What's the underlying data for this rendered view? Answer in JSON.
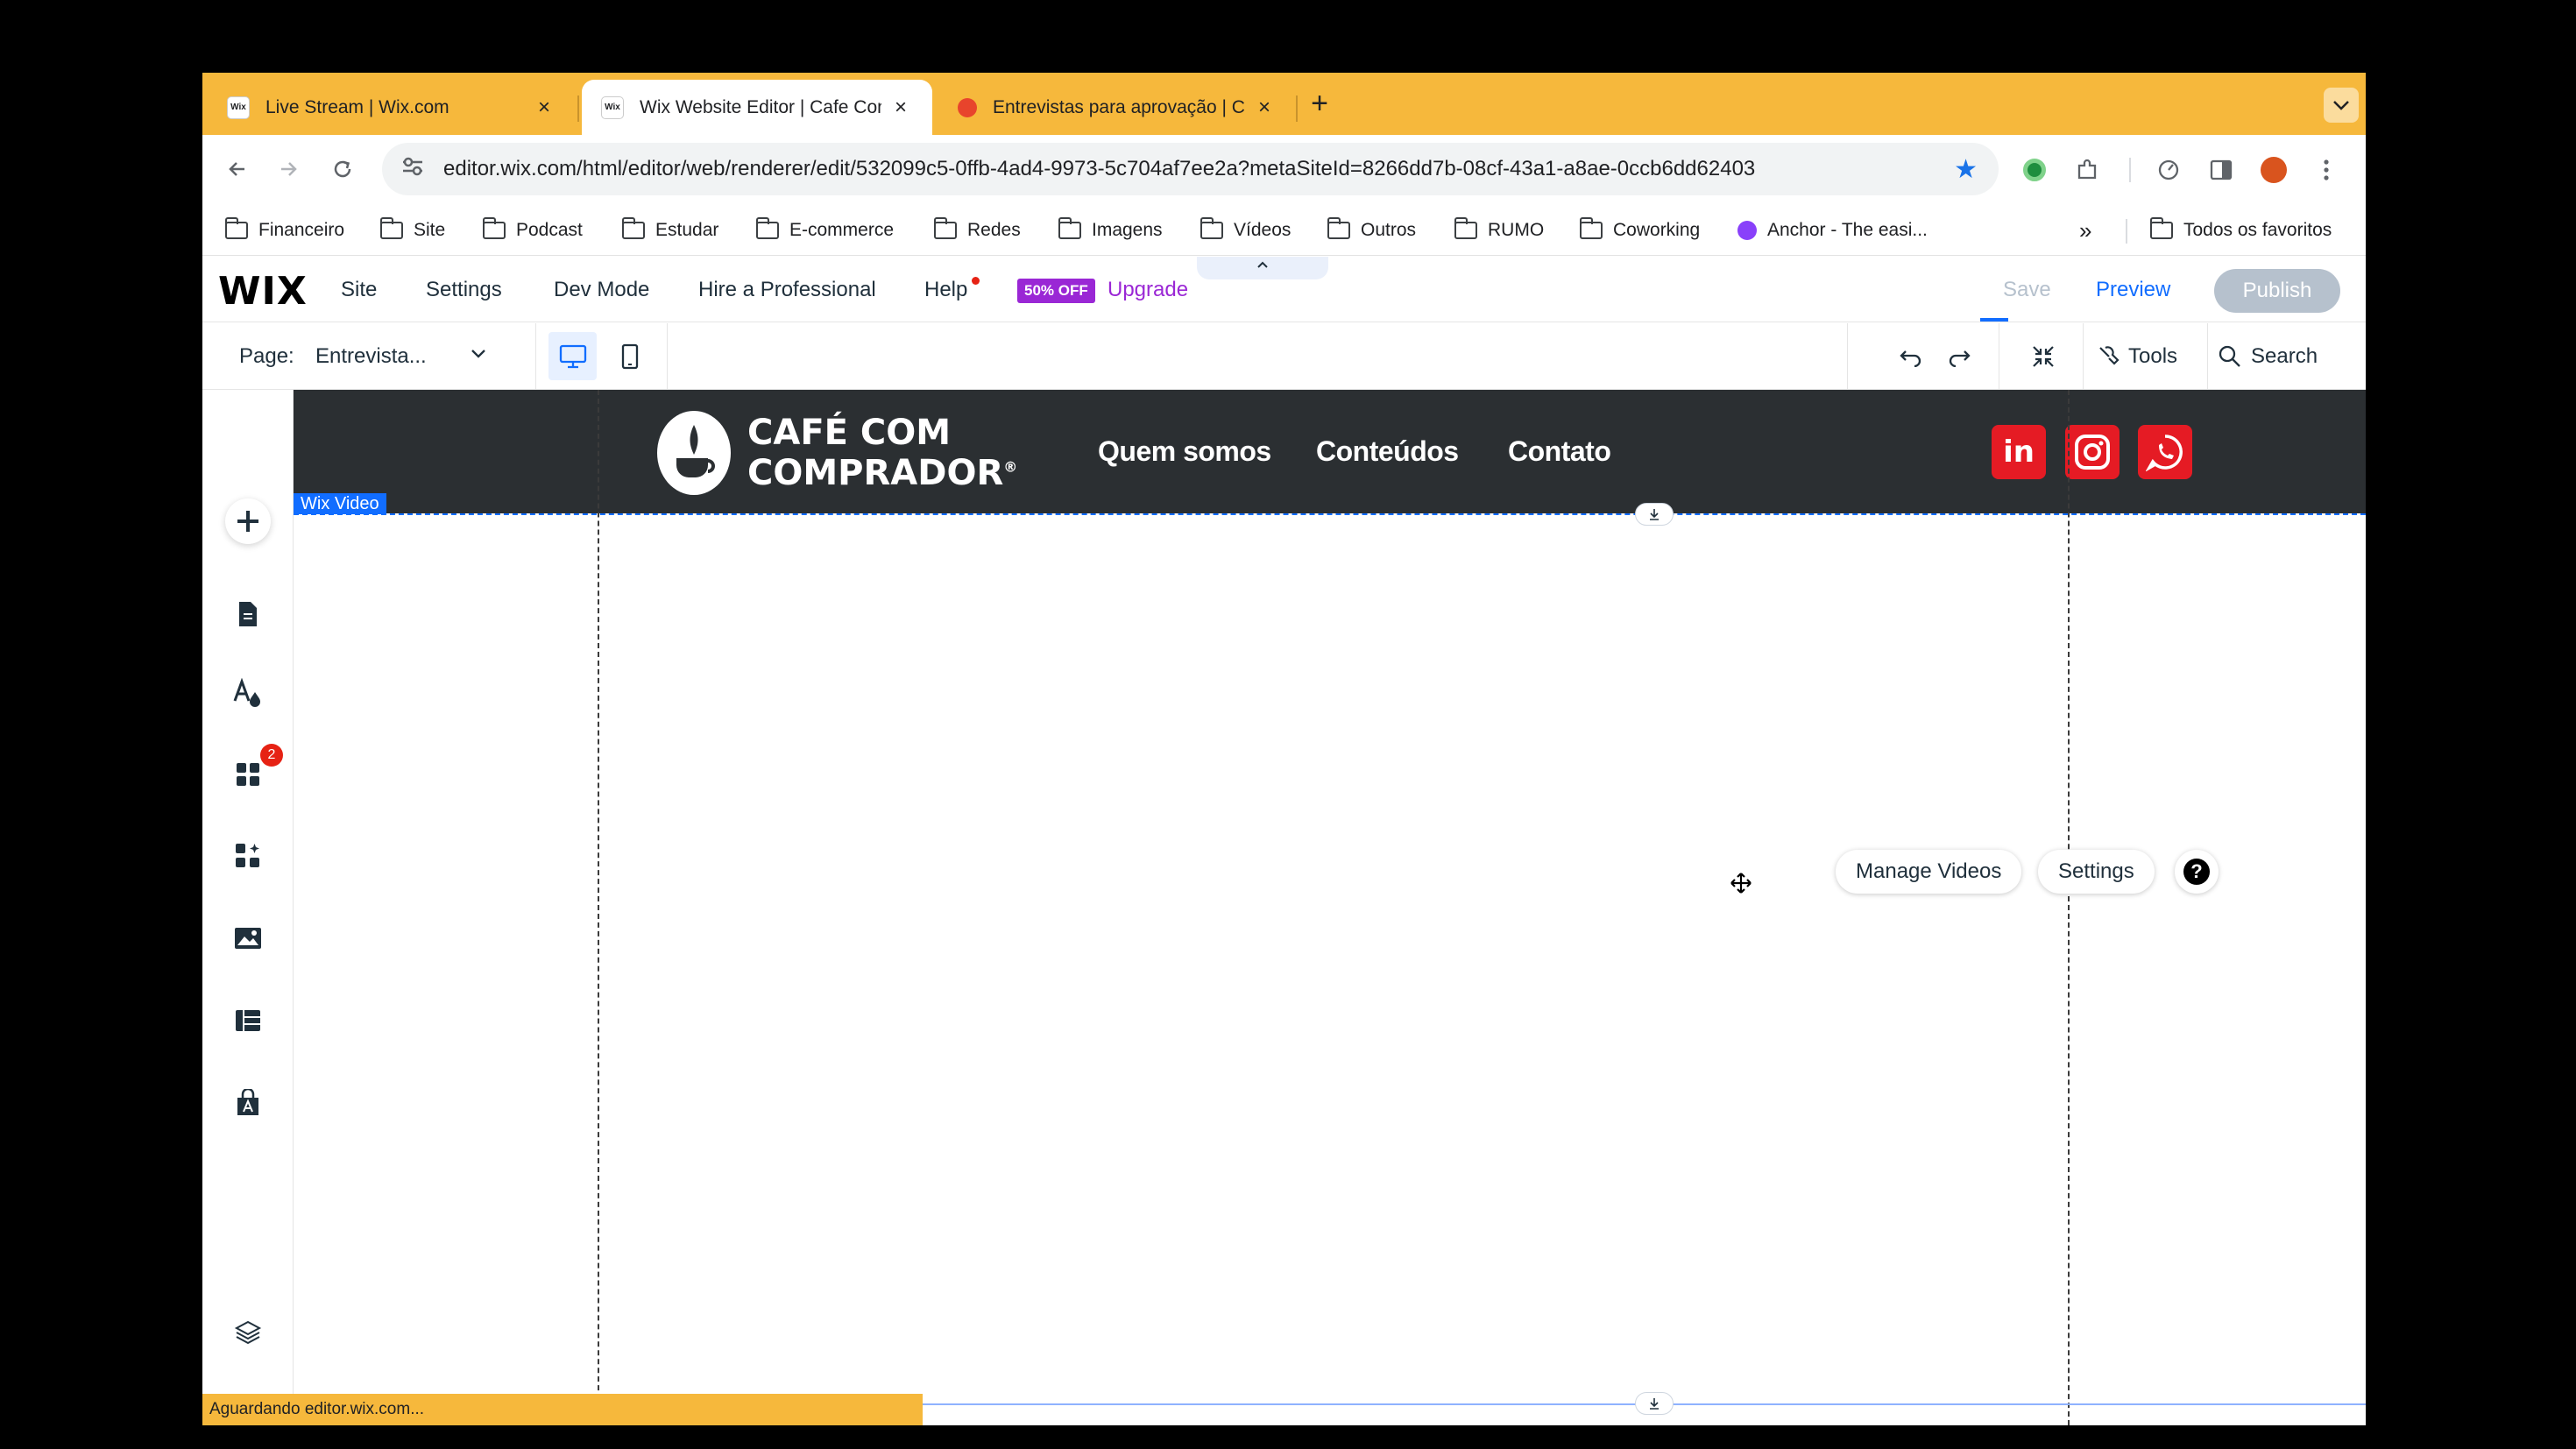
{
  "browser": {
    "tabs": [
      {
        "label": "Live Stream | Wix.com",
        "close": "×",
        "favicon_color": "#ffffff"
      },
      {
        "label": "Wix Website Editor | Cafe Com",
        "close": "×",
        "favicon_color": "#ffffff"
      },
      {
        "label": "Entrevistas para aprovação | C",
        "close": "×",
        "favicon_color": "#e8442c"
      }
    ],
    "new_tab": "+",
    "url": "editor.wix.com/html/editor/web/renderer/edit/532099c5-0ffb-4ad4-9973-5c704af7ee2a?metaSiteId=8266dd7b-08cf-43a1-a8ae-0ccb6dd62403",
    "bookmarks": [
      "Financeiro",
      "Site",
      "Podcast",
      "Estudar",
      "E-commerce",
      "Redes",
      "Imagens",
      "Vídeos",
      "Outros",
      "RUMO",
      "Coworking",
      "Anchor - The easi..."
    ],
    "bookmarks_overflow": "»",
    "all_bookmarks": "Todos os favoritos",
    "status": "Aguardando editor.wix.com..."
  },
  "wix": {
    "logo": "WIX",
    "menu": [
      "Site",
      "Settings",
      "Dev Mode",
      "Hire a Professional",
      "Help"
    ],
    "badge": "50% OFF",
    "upgrade": "Upgrade",
    "save": "Save",
    "preview": "Preview",
    "publish": "Publish",
    "page_label": "Page:",
    "page_value": "Entrevista...",
    "tools": "Tools",
    "search": "Search",
    "apps_badge_count": "2"
  },
  "canvas": {
    "element_tag": "Wix Video",
    "logo_line1": "CAFÉ COM",
    "logo_line2": "COMPRADOR",
    "logo_reg": "®",
    "nav": [
      "Quem somos",
      "Conteúdos",
      "Contato"
    ],
    "social": [
      "linkedin-icon",
      "instagram-icon",
      "whatsapp-icon"
    ],
    "manage_videos": "Manage Videos",
    "settings": "Settings",
    "help": "?"
  },
  "colors": {
    "tab_bar": "#f6b83c",
    "wix_blue": "#116dff",
    "upgrade_purple": "#9a27d5",
    "site_header": "#2b2f32",
    "social_red": "#e51b24"
  }
}
